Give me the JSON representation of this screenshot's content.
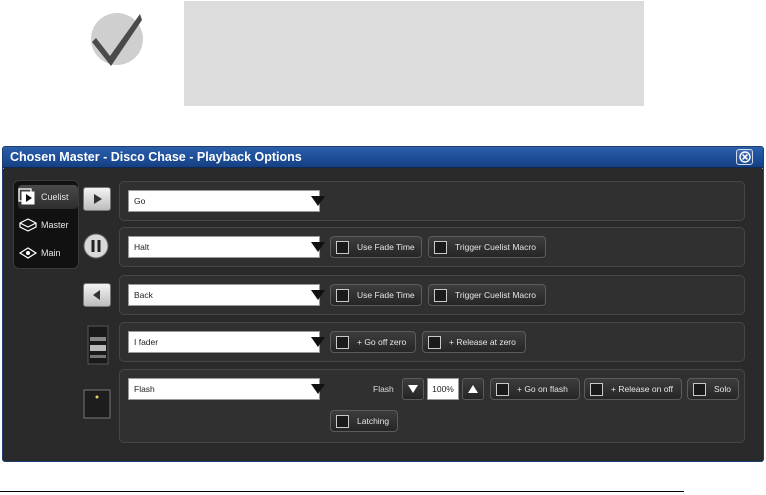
{
  "window": {
    "title": "Chosen Master - Disco Chase - Playback Options"
  },
  "modes": [
    {
      "label": "Cuelist",
      "icon": "cuelist-icon",
      "selected": true
    },
    {
      "label": "Master",
      "icon": "master-icon",
      "selected": false
    },
    {
      "label": "Main",
      "icon": "main-icon",
      "selected": false
    }
  ],
  "rows": {
    "go": {
      "dropdown": "Go"
    },
    "halt": {
      "dropdown": "Halt",
      "use_fade_time": "Use Fade Time",
      "trigger_macro": "Trigger Cuelist Macro"
    },
    "back": {
      "dropdown": "Back",
      "use_fade_time": "Use Fade Time",
      "trigger_macro": "Trigger Cuelist Macro"
    },
    "fader": {
      "dropdown": "I fader",
      "go_off_zero": "+ Go off zero",
      "release_at_zero": "+ Release at zero"
    },
    "flash": {
      "dropdown": "Flash",
      "flash_label": "Flash",
      "level": "100%",
      "go_on_flash": "+ Go on flash",
      "release_on_off": "+ Release on off",
      "solo": "Solo",
      "latching": "Latching"
    }
  },
  "colors": {
    "titlebar": "#1c4d97",
    "panel": "#2a2a2a"
  }
}
